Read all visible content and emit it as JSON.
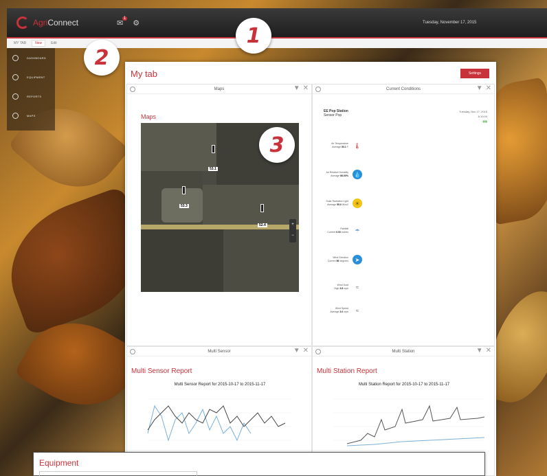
{
  "app": {
    "logo_prefix": "Agri",
    "logo_suffix": "Connect",
    "date": "Tuesday, November 17, 2015"
  },
  "top_icons": [
    {
      "name": "alerts",
      "badge": "1"
    },
    {
      "name": "settings",
      "label": ""
    }
  ],
  "breadcrumb": [
    "MY TAB",
    "New",
    "Edit"
  ],
  "sidebar": {
    "items": [
      {
        "label": "DASHBOARD",
        "icon": "dashboard-icon"
      },
      {
        "label": "EQUIPMENT",
        "icon": "equipment-icon"
      },
      {
        "label": "REPORTS",
        "icon": "reports-icon"
      },
      {
        "label": "MAPS",
        "icon": "maps-icon"
      }
    ]
  },
  "callouts": [
    "1",
    "2",
    "3"
  ],
  "main": {
    "tab_title": "My tab",
    "settings_button": "Settings"
  },
  "widgets": {
    "maps": {
      "header": "Maps",
      "title": "Maps",
      "pins": [
        "53.1",
        "53.3",
        "52.4"
      ]
    },
    "conditions": {
      "header": "Current Conditions",
      "station_name": "EE Pop Station",
      "station_sub": "Sensor Pop",
      "date": "Tuesday, Nov 17, 2015",
      "time": "8:10:00",
      "rows": [
        {
          "label": "Air Temperature",
          "value_label": "Average",
          "value": "53.1",
          "unit": "F",
          "icon": "thermometer-icon"
        },
        {
          "label": "Air Relative Humidity",
          "value_label": "Average",
          "value": "86.00%",
          "unit": "",
          "icon": "humidity-icon"
        },
        {
          "label": "Solar Radiation Light",
          "value_label": "Average",
          "value": "55.0",
          "unit": "W/m2",
          "icon": "sun-icon"
        },
        {
          "label": "Rainfall",
          "value_label": "Current",
          "value": "0.00",
          "unit": "inches",
          "icon": "rain-icon"
        },
        {
          "label": "Wind Direction",
          "value_label": "Current",
          "value": "56",
          "unit": "degrees",
          "icon": "wind-direction-icon"
        },
        {
          "label": "Wind Gust",
          "value_label": "High",
          "value": "3.8",
          "unit": "mph",
          "icon": "wind-gust-icon"
        },
        {
          "label": "Wind Speed",
          "value_label": "Average",
          "value": "3.0",
          "unit": "mph",
          "icon": "wind-speed-icon"
        }
      ]
    },
    "multi_sensor": {
      "header": "Multi Sensor",
      "title": "Multi Sensor Report",
      "subtitle": "Multi Sensor Report for 2015-10-17 to 2015-11-17"
    },
    "multi_station": {
      "header": "Multi Station",
      "title": "Multi Station Report",
      "subtitle": "Multi Station Report for 2015-10-17 to 2015-11-17"
    }
  },
  "equipment": {
    "title": "Equipment"
  },
  "colors": {
    "accent": "#c8323a",
    "topbar": "#2a2a2a"
  }
}
